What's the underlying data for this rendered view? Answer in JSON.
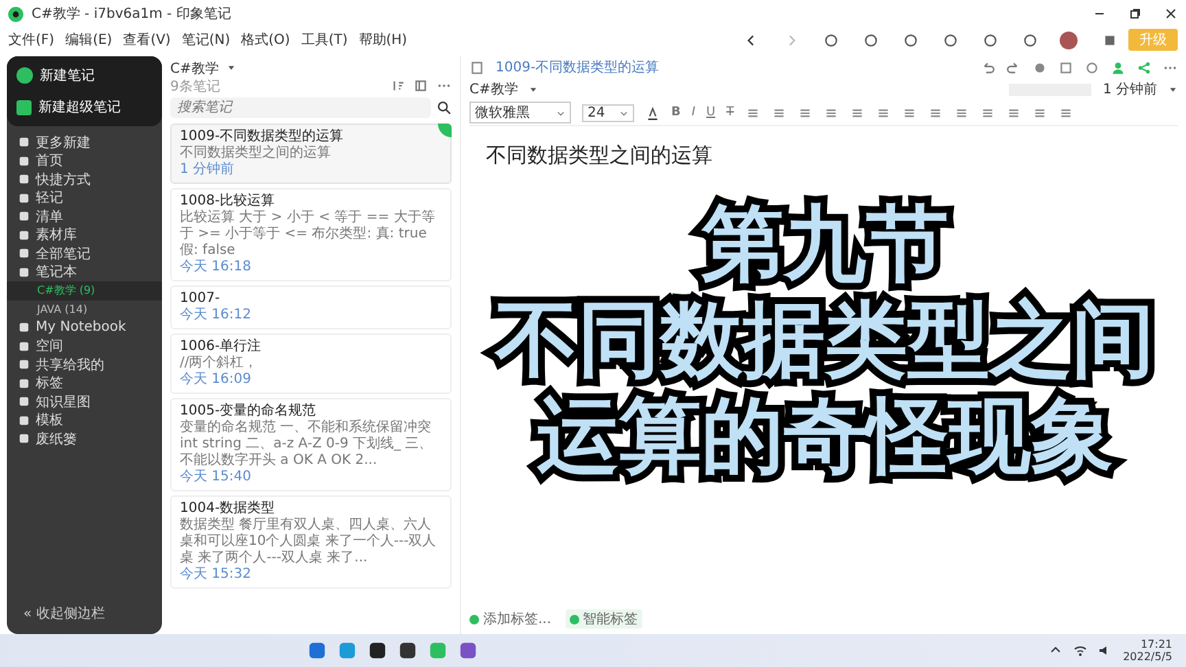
{
  "window": {
    "title": "C#教学 - i7bv6a1m - 印象笔记"
  },
  "menu": [
    "文件(F)",
    "编辑(E)",
    "查看(V)",
    "笔记(N)",
    "格式(O)",
    "工具(T)",
    "帮助(H)"
  ],
  "upgrade_button": "升级",
  "sidebar": {
    "new_note": "新建笔记",
    "new_super_note": "新建超级笔记",
    "items": [
      {
        "label": "更多新建",
        "selected": false
      },
      {
        "label": "首页",
        "selected": false
      },
      {
        "label": "快捷方式",
        "selected": false
      },
      {
        "label": "轻记",
        "selected": false
      },
      {
        "label": "清单",
        "selected": false
      },
      {
        "label": "素材库",
        "selected": false
      },
      {
        "label": "全部笔记",
        "selected": false
      },
      {
        "label": "笔记本",
        "selected": false,
        "children": [
          {
            "label": "C#教学 (9)",
            "selected": true
          },
          {
            "label": "JAVA (14)",
            "selected": false
          }
        ]
      },
      {
        "label": "My Notebook",
        "selected": false
      },
      {
        "label": "空间",
        "selected": false
      },
      {
        "label": "共享给我的",
        "selected": false
      },
      {
        "label": "标签",
        "selected": false
      },
      {
        "label": "知识星图",
        "selected": false
      },
      {
        "label": "模板",
        "selected": false
      },
      {
        "label": "废纸篓",
        "selected": false
      }
    ],
    "collapse": {
      "glyph": "«",
      "label": "收起侧边栏"
    }
  },
  "note_list": {
    "notebook": "C#教学",
    "count": "9条笔记",
    "search": {
      "placeholder": "搜索笔记"
    },
    "notes": [
      {
        "title": "1009-不同数据类型的运算",
        "snippet": "不同数据类型之间的运算",
        "time": "1 分钟前",
        "selected": true
      },
      {
        "title": "1008-比较运算",
        "snippet": "比较运算 大于 > 小于 < 等于 == 大于等于 >= 小于等于 <= 布尔类型: 真: true 假: false",
        "time": "今天 16:18",
        "selected": false
      },
      {
        "title": "1007-",
        "time": "今天 16:12",
        "selected": false
      },
      {
        "title": "1006-单行注",
        "snippet": "//两个斜杠，",
        "time": "今天 16:09",
        "selected": false
      },
      {
        "title": "1005-变量的命名规范",
        "snippet": "变量的命名规范 一、不能和系统保留冲突 int string 二、a-z A-Z 0-9 下划线_ 三、不能以数字开头 a OK A OK 2...",
        "time": "今天 15:40",
        "selected": false
      },
      {
        "title": "1004-数据类型",
        "snippet": "数据类型 餐厅里有双人桌、四人桌、六人桌和可以座10个人圆桌 来了一个人---双人桌 来了两个人---双人桌 来了...",
        "time": "今天 15:32",
        "selected": false
      }
    ]
  },
  "editor": {
    "note_title": "1009-不同数据类型的运算",
    "notebook": "C#教学",
    "updated": "1 分钟前",
    "font": "微软雅黑",
    "size": "24",
    "format_buttons": [
      "B",
      "I",
      "U",
      "T"
    ],
    "heading": "不同数据类型之间的运算",
    "tags": {
      "add": "添加标签...",
      "smart": "智能标签"
    }
  },
  "overlay": {
    "lines": [
      "第九节",
      "不同数据类型之间",
      "运算的奇怪现象"
    ]
  },
  "taskbar": {
    "time": "17:21",
    "date": "2022/5/5"
  }
}
